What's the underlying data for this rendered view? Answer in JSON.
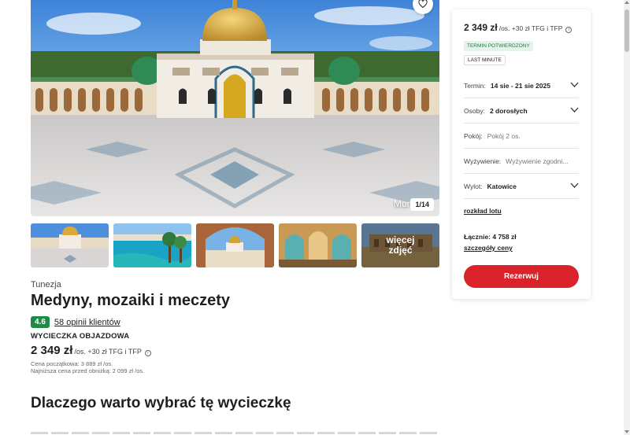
{
  "gallery": {
    "hero_caption": "Mon",
    "counter": "1/14",
    "more_label": "więcej zdjęć"
  },
  "offer": {
    "country": "Tunezja",
    "title": "Medyny, mozaiki i meczety",
    "rating": "4.6",
    "reviews": "58 opinii klientów",
    "trip_type": "WYCIECZKA OBJAZDOWA",
    "price": "2 349 zł",
    "price_suffix": "/os. +30 zł TFG i TFP",
    "start_price": "Cena początkowa: 3 889 zł /os.",
    "lowest_price": "Najniższa cena przed obniżką: 2 099 zł /os.",
    "section_title": "Dlaczego warto wybrać tę wycieczkę"
  },
  "booking": {
    "price": "2 349 zł",
    "price_suffix": "/os. +30 zł TFG i TFP",
    "badge_confirmed": "TERMIN POTWIERDZONY",
    "badge_last_minute": "LAST MINUTE",
    "fields": [
      {
        "label": "Termin:",
        "value": "14 sie - 21 sie 2025"
      },
      {
        "label": "Osoby:",
        "value": "2 dorosłych"
      },
      {
        "label": "Pokój:",
        "value": "Pokój 2 os."
      },
      {
        "label": "Wyżywienie:",
        "value": "Wyżywienie zgodni..."
      },
      {
        "label": "Wylot:",
        "value": "Katowice"
      }
    ],
    "flight_schedule": "rozkład lotu",
    "total": "Łącznie: 4 758 zł",
    "price_details": "szczegóły ceny",
    "book_button": "Rezerwuj"
  },
  "colors": {
    "accent": "#d9222a",
    "rating": "#1f8a43",
    "confirmed_bg": "#e4f4ea",
    "confirmed_text": "#1f7a3e"
  },
  "icons": {
    "favorite": "heart-icon",
    "dropdown": "chevron-down-icon",
    "info": "info-icon"
  }
}
